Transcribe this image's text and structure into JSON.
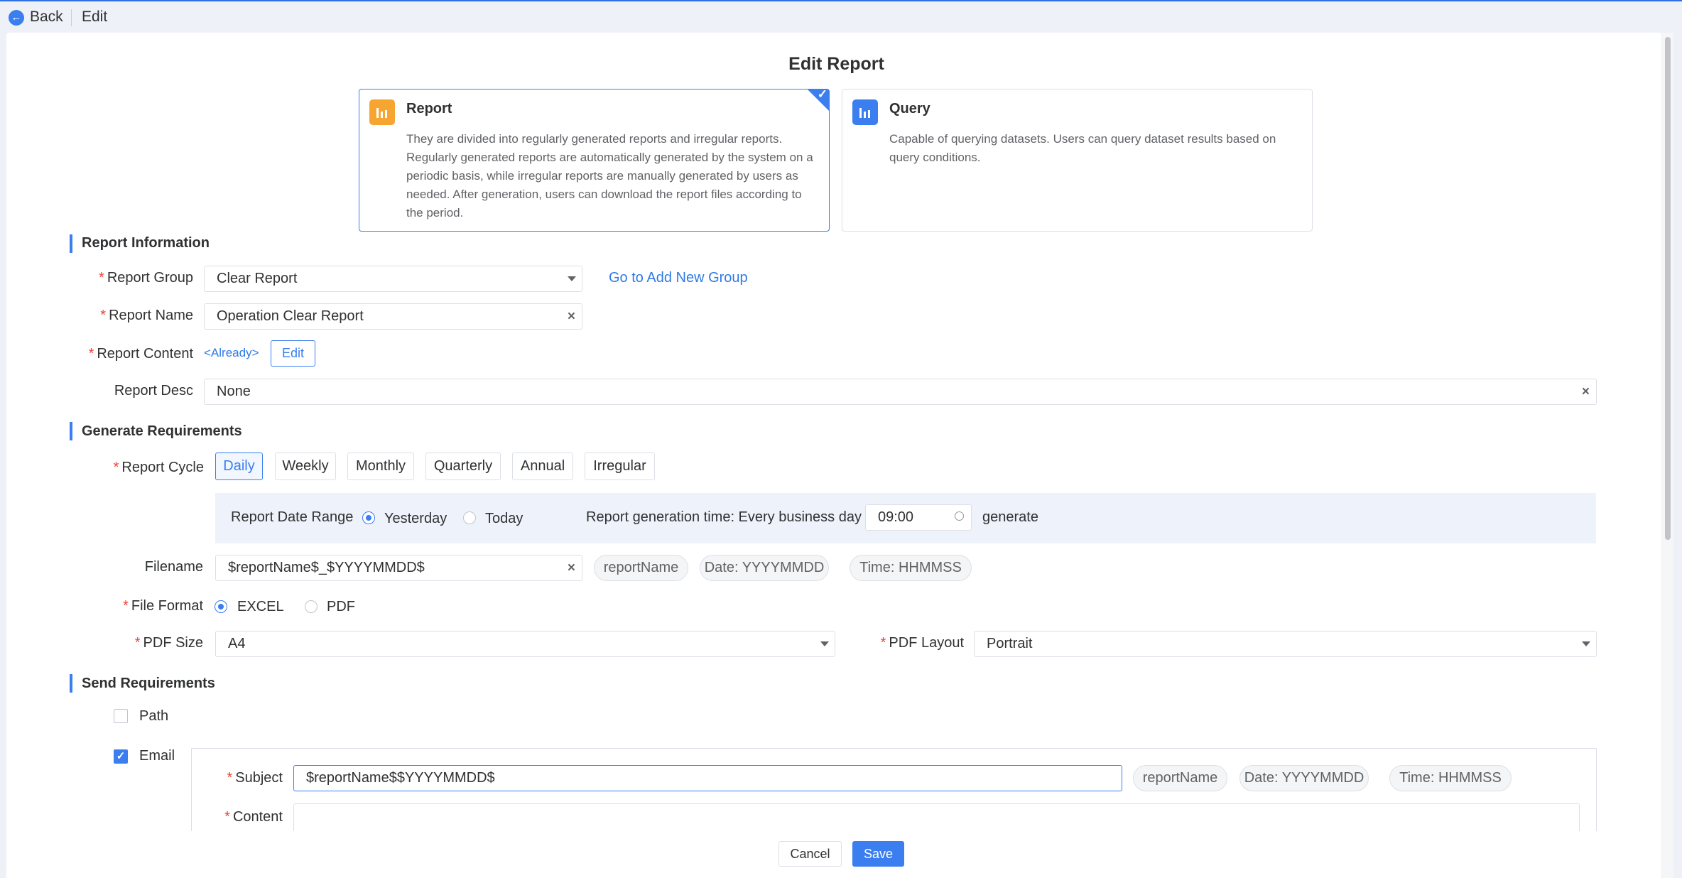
{
  "topbar": {
    "back_label": "Back",
    "edit_label": "Edit"
  },
  "page_title": "Edit Report",
  "type_cards": {
    "report": {
      "title": "Report",
      "description": "They are divided into regularly generated reports and irregular reports. Regularly generated reports are automatically generated by the system on a periodic basis, while irregular reports are manually generated by users as needed. After generation, users can download the report files according to the period.",
      "selected": true,
      "icon": "bar-chart-icon",
      "icon_color": "#f7a531"
    },
    "query": {
      "title": "Query",
      "description": "Capable of querying datasets. Users can query dataset results based on query conditions.",
      "selected": false,
      "icon": "bar-chart-icon",
      "icon_color": "#3a7ef0"
    }
  },
  "report_info": {
    "section_title": "Report Information",
    "group_label": "Report Group",
    "group_value": "Clear Report",
    "add_group_link": "Go to Add New Group",
    "name_label": "Report Name",
    "name_value": "Operation Clear Report",
    "content_label": "Report Content",
    "content_status": "<Already>",
    "content_edit": "Edit",
    "desc_label": "Report Desc",
    "desc_value": "None"
  },
  "generate": {
    "section_title": "Generate Requirements",
    "cycle_label": "Report Cycle",
    "cycles": [
      "Daily",
      "Weekly",
      "Monthly",
      "Quarterly",
      "Annual",
      "Irregular"
    ],
    "active_cycle": "Daily",
    "date_range_label": "Report Date Range",
    "date_options": [
      "Yesterday",
      "Today"
    ],
    "date_selected": "Yesterday",
    "gen_time_label": "Report generation time: Every business day",
    "gen_time_value": "09:00",
    "gen_suffix": "generate",
    "filename_label": "Filename",
    "filename_value": "$reportName$_$YYYYMMDD$",
    "filename_tags": [
      "reportName",
      "Date: YYYYMMDD",
      "Time: HHMMSS"
    ],
    "format_label": "File Format",
    "format_options": [
      "EXCEL",
      "PDF"
    ],
    "format_selected": "EXCEL",
    "pdf_size_label": "PDF Size",
    "pdf_size_value": "A4",
    "pdf_layout_label": "PDF Layout",
    "pdf_layout_value": "Portrait"
  },
  "send": {
    "section_title": "Send Requirements",
    "path_label": "Path",
    "path_checked": false,
    "email_label": "Email",
    "email_checked": true,
    "subject_label": "Subject",
    "subject_value": "$reportName$$YYYYMMDD$",
    "subject_tags": [
      "reportName",
      "Date: YYYYMMDD",
      "Time: HHMMSS"
    ],
    "content_label": "Content",
    "content_value": ""
  },
  "footer": {
    "cancel_label": "Cancel",
    "save_label": "Save"
  },
  "colors": {
    "accent": "#3a7ef0",
    "required": "#f04134",
    "report_icon": "#f7a531"
  }
}
